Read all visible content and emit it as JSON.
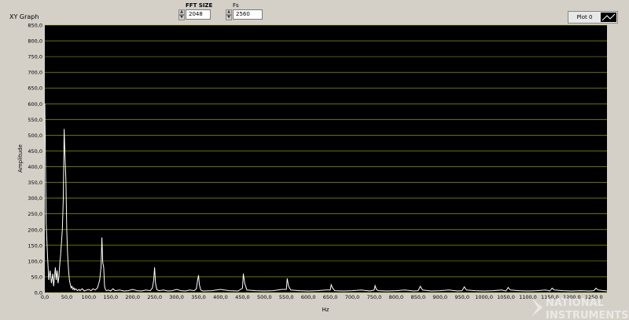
{
  "graph": {
    "title": "XY Graph",
    "legend_label": "Plot 0",
    "ylabel": "Amplitude",
    "xlabel": "Hz"
  },
  "controls": {
    "fft_size": {
      "label": "FFT SIZE",
      "value": "2048"
    },
    "fs": {
      "label": "Fs",
      "value": "2560"
    }
  },
  "watermark": "NATIONAL INSTRUMENTS",
  "colors": {
    "plot_bg": "#000000",
    "grid": "#a8b400",
    "trace": "#ffffff",
    "panel": "#d4d0c8"
  },
  "chart_data": {
    "type": "line",
    "title": "XY Graph",
    "xlabel": "Hz",
    "ylabel": "Amplitude",
    "xlim": [
      0,
      1280
    ],
    "ylim": [
      0,
      850
    ],
    "grid": true,
    "legend": "top-right",
    "y_ticks": [
      "0,0",
      "50,0",
      "100,0",
      "150,0",
      "200,0",
      "250,0",
      "300,0",
      "350,0",
      "400,0",
      "450,0",
      "500,0",
      "550,0",
      "600,0",
      "650,0",
      "700,0",
      "750,0",
      "800,0",
      "850,0"
    ],
    "x_ticks": [
      "0,0",
      "50,0",
      "100,0",
      "150,0",
      "200,0",
      "250,0",
      "300,0",
      "350,0",
      "400,0",
      "450,0",
      "500,0",
      "550,0",
      "600,0",
      "650,0",
      "700,0",
      "750,0",
      "800,0",
      "850,0",
      "900,0",
      "950,0",
      "1000,0",
      "1050,0",
      "1100,0",
      "1150,0",
      "1200,0",
      "1250,0"
    ],
    "series": [
      {
        "values_x": [
          0,
          3,
          6,
          9,
          12,
          15,
          18,
          20,
          22,
          24,
          26,
          28,
          30,
          32,
          34,
          36,
          38,
          40,
          42,
          44,
          46,
          48,
          50,
          52,
          54,
          56,
          58,
          60,
          62,
          64,
          66,
          68,
          70,
          72,
          74,
          76,
          78,
          80,
          85,
          90,
          95,
          100,
          105,
          110,
          115,
          120,
          125,
          128,
          130,
          132,
          134,
          136,
          138,
          140,
          145,
          150,
          155,
          160,
          170,
          180,
          190,
          200,
          210,
          220,
          230,
          240,
          245,
          248,
          250,
          252,
          255,
          260,
          270,
          280,
          290,
          300,
          310,
          320,
          330,
          340,
          345,
          348,
          350,
          352,
          355,
          360,
          380,
          400,
          420,
          440,
          450,
          452,
          455,
          460,
          480,
          500,
          520,
          540,
          550,
          552,
          555,
          560,
          580,
          600,
          620,
          640,
          650,
          652,
          655,
          660,
          680,
          700,
          720,
          740,
          750,
          752,
          755,
          760,
          780,
          800,
          820,
          840,
          850,
          855,
          860,
          880,
          900,
          920,
          940,
          950,
          955,
          960,
          980,
          1000,
          1020,
          1040,
          1050,
          1055,
          1060,
          1080,
          1100,
          1120,
          1140,
          1150,
          1155,
          1160,
          1180,
          1200,
          1220,
          1240,
          1250,
          1255,
          1260,
          1280
        ],
        "values_y": [
          600,
          220,
          120,
          40,
          70,
          30,
          60,
          20,
          50,
          80,
          40,
          70,
          30,
          50,
          90,
          120,
          160,
          200,
          300,
          520,
          430,
          360,
          200,
          120,
          70,
          40,
          25,
          15,
          20,
          10,
          15,
          8,
          12,
          10,
          6,
          8,
          10,
          6,
          12,
          5,
          8,
          10,
          6,
          12,
          8,
          15,
          40,
          80,
          175,
          95,
          80,
          20,
          10,
          6,
          8,
          5,
          12,
          6,
          8,
          5,
          6,
          10,
          6,
          5,
          8,
          6,
          15,
          40,
          80,
          30,
          10,
          6,
          8,
          5,
          6,
          10,
          6,
          5,
          8,
          6,
          12,
          40,
          55,
          25,
          8,
          5,
          6,
          10,
          6,
          5,
          14,
          60,
          30,
          8,
          6,
          5,
          6,
          10,
          10,
          45,
          20,
          8,
          6,
          5,
          6,
          8,
          8,
          25,
          15,
          6,
          5,
          6,
          8,
          5,
          8,
          22,
          10,
          6,
          5,
          6,
          8,
          5,
          6,
          20,
          8,
          5,
          6,
          8,
          5,
          6,
          18,
          8,
          6,
          5,
          6,
          8,
          5,
          16,
          8,
          6,
          5,
          6,
          8,
          5,
          14,
          8,
          6,
          5,
          6,
          5,
          6,
          14,
          8,
          5
        ]
      }
    ]
  }
}
